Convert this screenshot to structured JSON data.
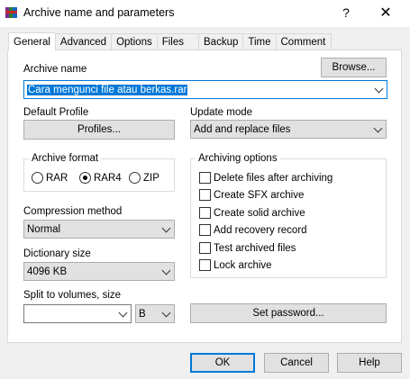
{
  "window": {
    "title": "Archive name and parameters",
    "help_glyph": "?",
    "close_glyph": "✕"
  },
  "tabs": [
    {
      "label": "General",
      "active": true
    },
    {
      "label": "Advanced",
      "active": false
    },
    {
      "label": "Options",
      "active": false
    },
    {
      "label": "Files",
      "active": false
    },
    {
      "label": "Backup",
      "active": false
    },
    {
      "label": "Time",
      "active": false
    },
    {
      "label": "Comment",
      "active": false
    }
  ],
  "archive_name": {
    "label": "Archive name",
    "value": "Cara mengunci file atau berkas.rar",
    "browse_label": "Browse..."
  },
  "default_profile": {
    "label": "Default Profile",
    "button": "Profiles..."
  },
  "update_mode": {
    "label": "Update mode",
    "value": "Add and replace files"
  },
  "archive_format": {
    "title": "Archive format",
    "options": [
      "RAR",
      "RAR4",
      "ZIP"
    ],
    "selected": "RAR4"
  },
  "compression_method": {
    "label": "Compression method",
    "value": "Normal"
  },
  "dictionary_size": {
    "label": "Dictionary size",
    "value": "4096 KB"
  },
  "split_volumes": {
    "label": "Split to volumes, size",
    "value": "",
    "unit": "B"
  },
  "archiving_options": {
    "title": "Archiving options",
    "items": [
      {
        "label": "Delete files after archiving",
        "checked": false
      },
      {
        "label": "Create SFX archive",
        "checked": false
      },
      {
        "label": "Create solid archive",
        "checked": false
      },
      {
        "label": "Add recovery record",
        "checked": false
      },
      {
        "label": "Test archived files",
        "checked": false
      },
      {
        "label": "Lock archive",
        "checked": false
      }
    ]
  },
  "set_password": "Set password...",
  "footer": {
    "ok": "OK",
    "cancel": "Cancel",
    "help": "Help"
  },
  "colors": {
    "selection": "#0078d7",
    "dialog_bg": "#f0f0f0",
    "panel_bg": "#ffffff"
  },
  "icons": {
    "app": "winrar-books-icon"
  }
}
